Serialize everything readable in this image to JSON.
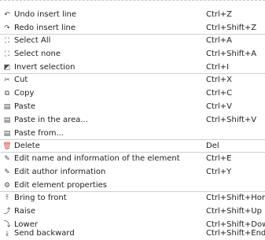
{
  "menu": {
    "items": [
      {
        "icon": "undo-icon",
        "glyph": "↶",
        "label": "Undo insert line",
        "shortcut": "Ctrl+Z"
      },
      {
        "icon": "redo-icon",
        "glyph": "↷",
        "label": "Redo insert line",
        "shortcut": "Ctrl+Shift+Z"
      },
      {
        "icon": "select-all-icon",
        "glyph": "⛶",
        "label": "Select All",
        "shortcut": "Ctrl+A"
      },
      {
        "icon": "select-none-icon",
        "glyph": "⛶",
        "label": "Select none",
        "shortcut": "Ctrl+Shift+A"
      },
      {
        "icon": "invert-selection-icon",
        "glyph": "◩",
        "label": "Invert selection",
        "shortcut": "Ctrl+I"
      },
      {
        "icon": "cut-icon",
        "glyph": "✂",
        "label": "Cut",
        "shortcut": "Ctrl+X"
      },
      {
        "icon": "copy-icon",
        "glyph": "⧉",
        "label": "Copy",
        "shortcut": "Ctrl+C"
      },
      {
        "icon": "paste-icon",
        "glyph": "▤",
        "label": "Paste",
        "shortcut": "Ctrl+V"
      },
      {
        "icon": "paste-area-icon",
        "glyph": "▤",
        "label": "Paste in the area...",
        "shortcut": "Ctrl+Shift+V"
      },
      {
        "icon": "paste-from-icon",
        "glyph": "▤",
        "label": "Paste from...",
        "shortcut": ""
      },
      {
        "icon": "delete-icon",
        "glyph": "🗑",
        "label": "Delete",
        "shortcut": "Del"
      },
      {
        "icon": "edit-name-icon",
        "glyph": "✎",
        "label": "Edit name and information of the element",
        "shortcut": "Ctrl+E"
      },
      {
        "icon": "edit-author-icon",
        "glyph": "✎",
        "label": "Edit author information",
        "shortcut": "Ctrl+Y"
      },
      {
        "icon": "edit-properties-icon",
        "glyph": "⚙",
        "label": "Edit element properties",
        "shortcut": ""
      },
      {
        "icon": "bring-to-front-icon",
        "glyph": "⤒",
        "label": "Bring to front",
        "shortcut": "Ctrl+Shift+Home"
      },
      {
        "icon": "raise-icon",
        "glyph": "⤴",
        "label": "Raise",
        "shortcut": "Ctrl+Shift+Up"
      },
      {
        "icon": "lower-icon",
        "glyph": "⤵",
        "label": "Lower",
        "shortcut": "Ctrl+Shift+Down"
      },
      {
        "icon": "send-backward-icon",
        "glyph": "⤓",
        "label": "Send backward",
        "shortcut": "Ctrl+Shift+End"
      }
    ]
  }
}
